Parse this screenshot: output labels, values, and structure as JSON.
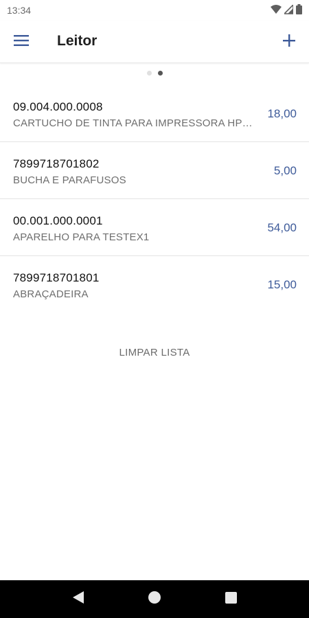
{
  "status_bar": {
    "time": "13:34",
    "icons": [
      "wifi-icon",
      "signal-icon",
      "battery-icon"
    ]
  },
  "app_bar": {
    "title": "Leitor",
    "menu_icon": "hamburger-menu-icon",
    "add_icon": "plus-icon"
  },
  "pager": {
    "page_count": 2,
    "active_page": 2
  },
  "items": [
    {
      "code": "09.004.000.0008",
      "description": "CARTUCHO DE TINTA PARA IMPRESSORA HP3...",
      "value": "18,00"
    },
    {
      "code": "7899718701802",
      "description": "BUCHA E PARAFUSOS",
      "value": "5,00"
    },
    {
      "code": "00.001.000.0001",
      "description": "APARELHO PARA TESTEX1",
      "value": "54,00"
    },
    {
      "code": "7899718701801",
      "description": "ABRAÇADEIRA",
      "value": "15,00"
    }
  ],
  "actions": {
    "clear_label": "LIMPAR LISTA"
  },
  "colors": {
    "accent": "#3d5a99",
    "primary_text": "#111111",
    "secondary_text": "#6e6e6e",
    "nav_bar": "#000000"
  },
  "nav_bar": {
    "icons": [
      "back-icon",
      "home-icon",
      "recents-icon"
    ]
  }
}
